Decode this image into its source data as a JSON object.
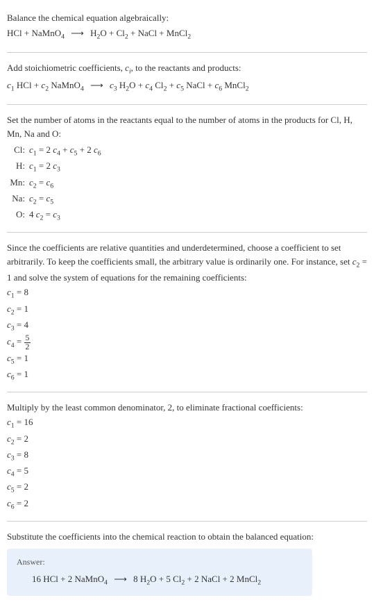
{
  "section1": {
    "title": "Balance the chemical equation algebraically:"
  },
  "section2": {
    "title": "Add stoichiometric coefficients, ",
    "title2": ", to the reactants and products:"
  },
  "section3": {
    "title": "Set the number of atoms in the reactants equal to the number of atoms in the products for Cl, H, Mn, Na and O:",
    "rows": [
      {
        "label": "Cl:"
      },
      {
        "label": "H:"
      },
      {
        "label": "Mn:"
      },
      {
        "label": "Na:"
      },
      {
        "label": "O:"
      }
    ]
  },
  "section4": {
    "title": "Since the coefficients are relative quantities and underdetermined, choose a coefficient to set arbitrarily. To keep the coefficients small, the arbitrary value is ordinarily one. For instance, set ",
    "title2": " = 1 and solve the system of equations for the remaining coefficients:",
    "coefs": {
      "c1": "8",
      "c2": "1",
      "c3": "4",
      "c4_num": "5",
      "c4_den": "2",
      "c5": "1",
      "c6": "1"
    }
  },
  "section5": {
    "title": "Multiply by the least common denominator, 2, to eliminate fractional coefficients:",
    "coefs": {
      "c1": "16",
      "c2": "2",
      "c3": "8",
      "c4": "5",
      "c5": "2",
      "c6": "2"
    }
  },
  "section6": {
    "title": "Substitute the coefficients into the chemical reaction to obtain the balanced equation:"
  },
  "answer": {
    "label": "Answer:"
  },
  "chart_data": {
    "type": "table",
    "title": "Stoichiometric coefficients for HCl + NaMnO4 -> H2O + Cl2 + NaCl + MnCl2",
    "atom_balance_equations": [
      {
        "element": "Cl",
        "equation": "c1 = 2*c4 + c5 + 2*c6"
      },
      {
        "element": "H",
        "equation": "c1 = 2*c3"
      },
      {
        "element": "Mn",
        "equation": "c2 = c6"
      },
      {
        "element": "Na",
        "equation": "c2 = c5"
      },
      {
        "element": "O",
        "equation": "4*c2 = c3"
      }
    ],
    "solution_c2_1": {
      "c1": 8,
      "c2": 1,
      "c3": 4,
      "c4": "5/2",
      "c5": 1,
      "c6": 1
    },
    "solution_integer": {
      "c1": 16,
      "c2": 2,
      "c3": 8,
      "c4": 5,
      "c5": 2,
      "c6": 2
    },
    "balanced_equation": "16 HCl + 2 NaMnO4 -> 8 H2O + 5 Cl2 + 2 NaCl + 2 MnCl2"
  }
}
